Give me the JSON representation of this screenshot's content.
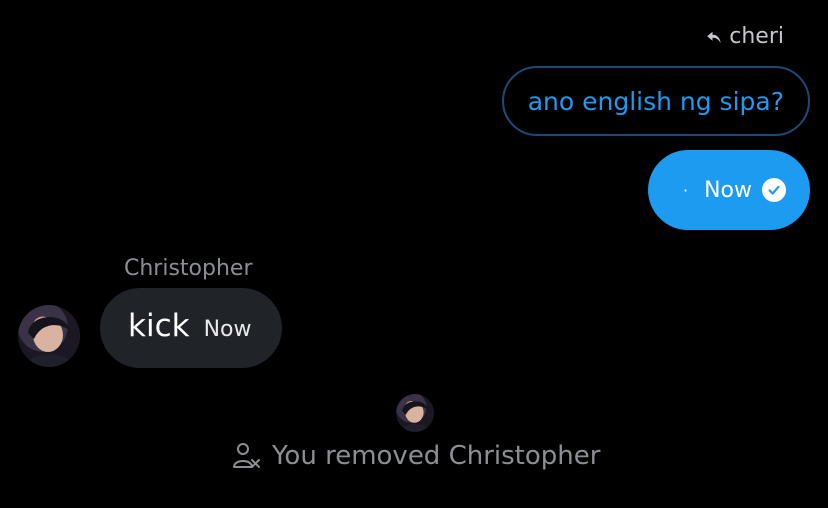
{
  "reply_reference": {
    "icon": "reply-arrow-icon",
    "name": "cheri"
  },
  "quoted_message": {
    "text": "ano english ng sipa?",
    "color": "#1d9bf0"
  },
  "sent_message": {
    "dot": "·",
    "timestamp": "Now",
    "status_icon": "check-circle-icon",
    "color": "#1d9bf0"
  },
  "received_message": {
    "sender": "Christopher",
    "text": "kick",
    "timestamp": "Now",
    "avatar": "user-avatar"
  },
  "system_event": {
    "icon": "user-remove-icon",
    "text": "You removed Christopher"
  }
}
